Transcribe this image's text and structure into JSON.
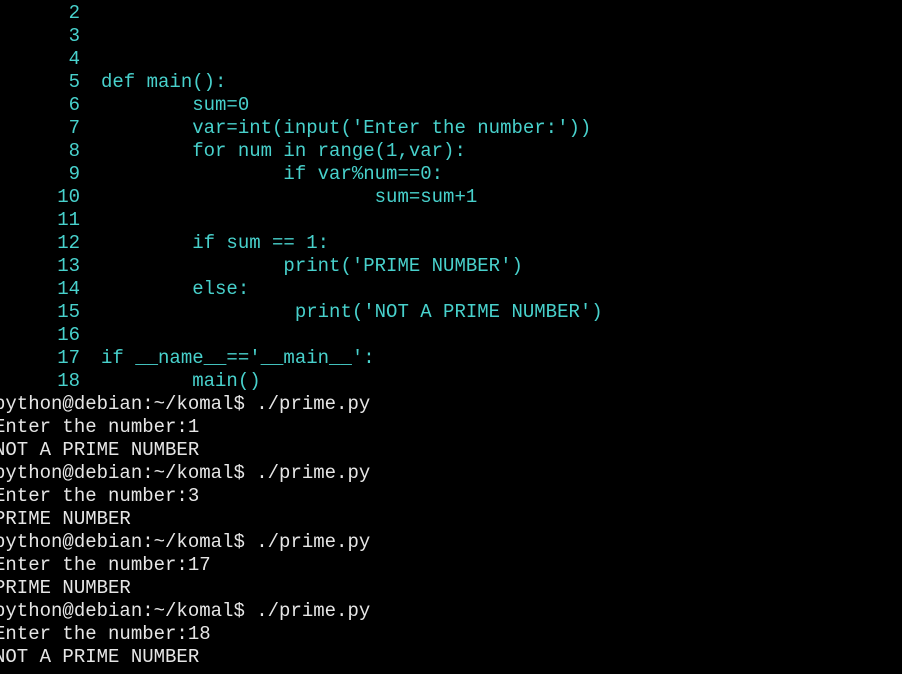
{
  "terminal": {
    "colors": {
      "background": "#000000",
      "code_text": "#48d1cc",
      "output_text": "#e6e6e6",
      "cursor": "#00ff00"
    },
    "code_lines": [
      {
        "num": "2",
        "text": ""
      },
      {
        "num": "3",
        "text": ""
      },
      {
        "num": "4",
        "text": ""
      },
      {
        "num": "5",
        "text": "def main():"
      },
      {
        "num": "6",
        "text": "        sum=0"
      },
      {
        "num": "7",
        "text": "        var=int(input('Enter the number:'))"
      },
      {
        "num": "8",
        "text": "        for num in range(1,var):"
      },
      {
        "num": "9",
        "text": "                if var%num==0:"
      },
      {
        "num": "10",
        "text": "                        sum=sum+1"
      },
      {
        "num": "11",
        "text": ""
      },
      {
        "num": "12",
        "text": "        if sum == 1:"
      },
      {
        "num": "13",
        "text": "                print('PRIME NUMBER')"
      },
      {
        "num": "14",
        "text": "        else:"
      },
      {
        "num": "15",
        "text": "                 print('NOT A PRIME NUMBER')"
      },
      {
        "num": "16",
        "text": ""
      },
      {
        "num": "17",
        "text": "if __name__=='__main__':"
      },
      {
        "num": "18",
        "text": "        main()"
      }
    ],
    "output_lines": [
      "python@debian:~/komal$ ./prime.py",
      "Enter the number:1",
      "NOT A PRIME NUMBER",
      "python@debian:~/komal$ ./prime.py",
      "Enter the number:3",
      "PRIME NUMBER",
      "python@debian:~/komal$ ./prime.py",
      "Enter the number:17",
      "PRIME NUMBER",
      "python@debian:~/komal$ ./prime.py",
      "Enter the number:18",
      "NOT A PRIME NUMBER"
    ]
  }
}
